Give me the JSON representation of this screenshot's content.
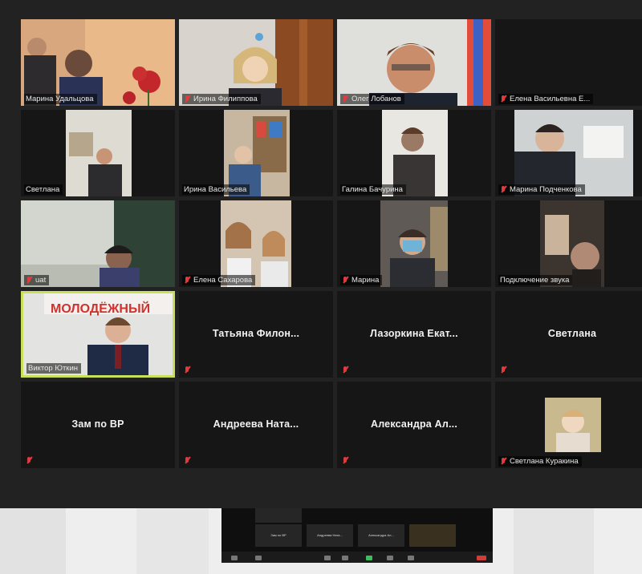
{
  "meeting": {
    "participants": [
      {
        "name": "Марина Удальцова"
      },
      {
        "name": "Ирина Филиппова"
      },
      {
        "name": "Олег Лобанов"
      },
      {
        "name": "Елена Васильевна Е..."
      },
      {
        "name": "Светлана"
      },
      {
        "name": "Ирина Васильева"
      },
      {
        "name": "Галина Бачурина"
      },
      {
        "name": "Марина Подченкова"
      },
      {
        "name": "uat"
      },
      {
        "name": "Елена Сахарова"
      },
      {
        "name": "Марина"
      },
      {
        "name": "Подключение звука"
      },
      {
        "name": "Виктор Юткин"
      },
      {
        "name": "Татьяна Филон..."
      },
      {
        "name": "Лазоркина Екат..."
      },
      {
        "name": "Светлана"
      },
      {
        "name": "Зам по ВР"
      },
      {
        "name": "Андреева Ната..."
      },
      {
        "name": "Александра Ал..."
      },
      {
        "name": "Светлана Куракина"
      }
    ],
    "background_text": "МОЛОДЁЖНЫЙ",
    "mini_labels": [
      "Зам по ВР",
      "Андреева Ната...",
      "Александра Ал..."
    ]
  },
  "colors": {
    "active_speaker_border": "#c8e05a",
    "muted_mic": "#e23b3b",
    "tile_bg": "#161616"
  },
  "icons": {
    "mic": "microphone-muted-icon"
  }
}
